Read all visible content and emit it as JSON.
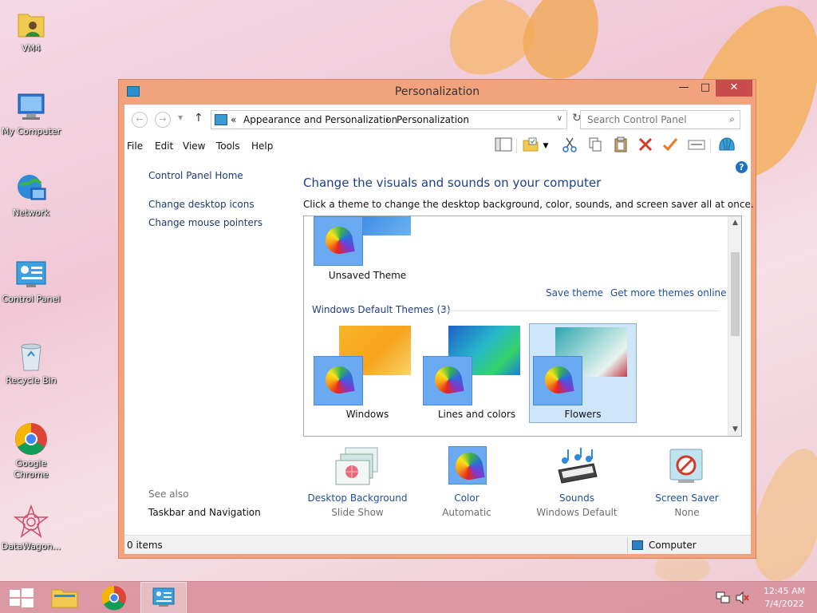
{
  "desktop": {
    "icons": [
      {
        "label": "VM4",
        "icon": "user-folder-icon"
      },
      {
        "label": "My Computer",
        "icon": "computer-icon"
      },
      {
        "label": "Network",
        "icon": "network-icon"
      },
      {
        "label": "Control Panel",
        "icon": "control-panel-icon"
      },
      {
        "label": "Recycle Bin",
        "icon": "recycle-bin-icon"
      },
      {
        "label": "Google Chrome",
        "icon": "chrome-icon"
      },
      {
        "label": "DataWagon...",
        "icon": "datawagon-icon"
      }
    ]
  },
  "window": {
    "title": "Personalization",
    "minimize": "—",
    "maximize": "□",
    "close": "✕",
    "address": {
      "prefix": "«",
      "crumbs": [
        "Appearance and Personalization",
        "Personalization"
      ],
      "separator": "›"
    },
    "search_placeholder": "Search Control Panel",
    "menu": [
      "File",
      "Edit",
      "View",
      "Tools",
      "Help"
    ],
    "left_pane": {
      "home": "Control Panel Home",
      "links": [
        "Change desktop icons",
        "Change mouse pointers"
      ],
      "see_also_title": "See also",
      "see_also": [
        "Taskbar and Navigation"
      ]
    },
    "heading": "Change the visuals and sounds on your computer",
    "subtext": "Click a theme to change the desktop background, color, sounds, and screen saver all at once.",
    "themes": {
      "unsaved": "Unsaved Theme",
      "save_link": "Save theme",
      "more_link": "Get more themes online",
      "group_title": "Windows Default Themes (3)",
      "items": [
        {
          "name": "Windows",
          "selected": false
        },
        {
          "name": "Lines and colors",
          "selected": false
        },
        {
          "name": "Flowers",
          "selected": true
        }
      ]
    },
    "bottom": [
      {
        "label": "Desktop Background",
        "value": "Slide Show"
      },
      {
        "label": "Color",
        "value": "Automatic"
      },
      {
        "label": "Sounds",
        "value": "Windows Default"
      },
      {
        "label": "Screen Saver",
        "value": "None"
      }
    ],
    "status": {
      "left": "0 items",
      "right": "Computer"
    }
  },
  "taskbar": {
    "time": "12:45 AM",
    "date": "7/4/2022"
  },
  "colors": {
    "window_frame": "#f2a37e",
    "close_button": "#c74d4d",
    "link": "#1e4e9c",
    "heading": "#1e3d8c",
    "selected_theme": "#cfe5fa"
  }
}
